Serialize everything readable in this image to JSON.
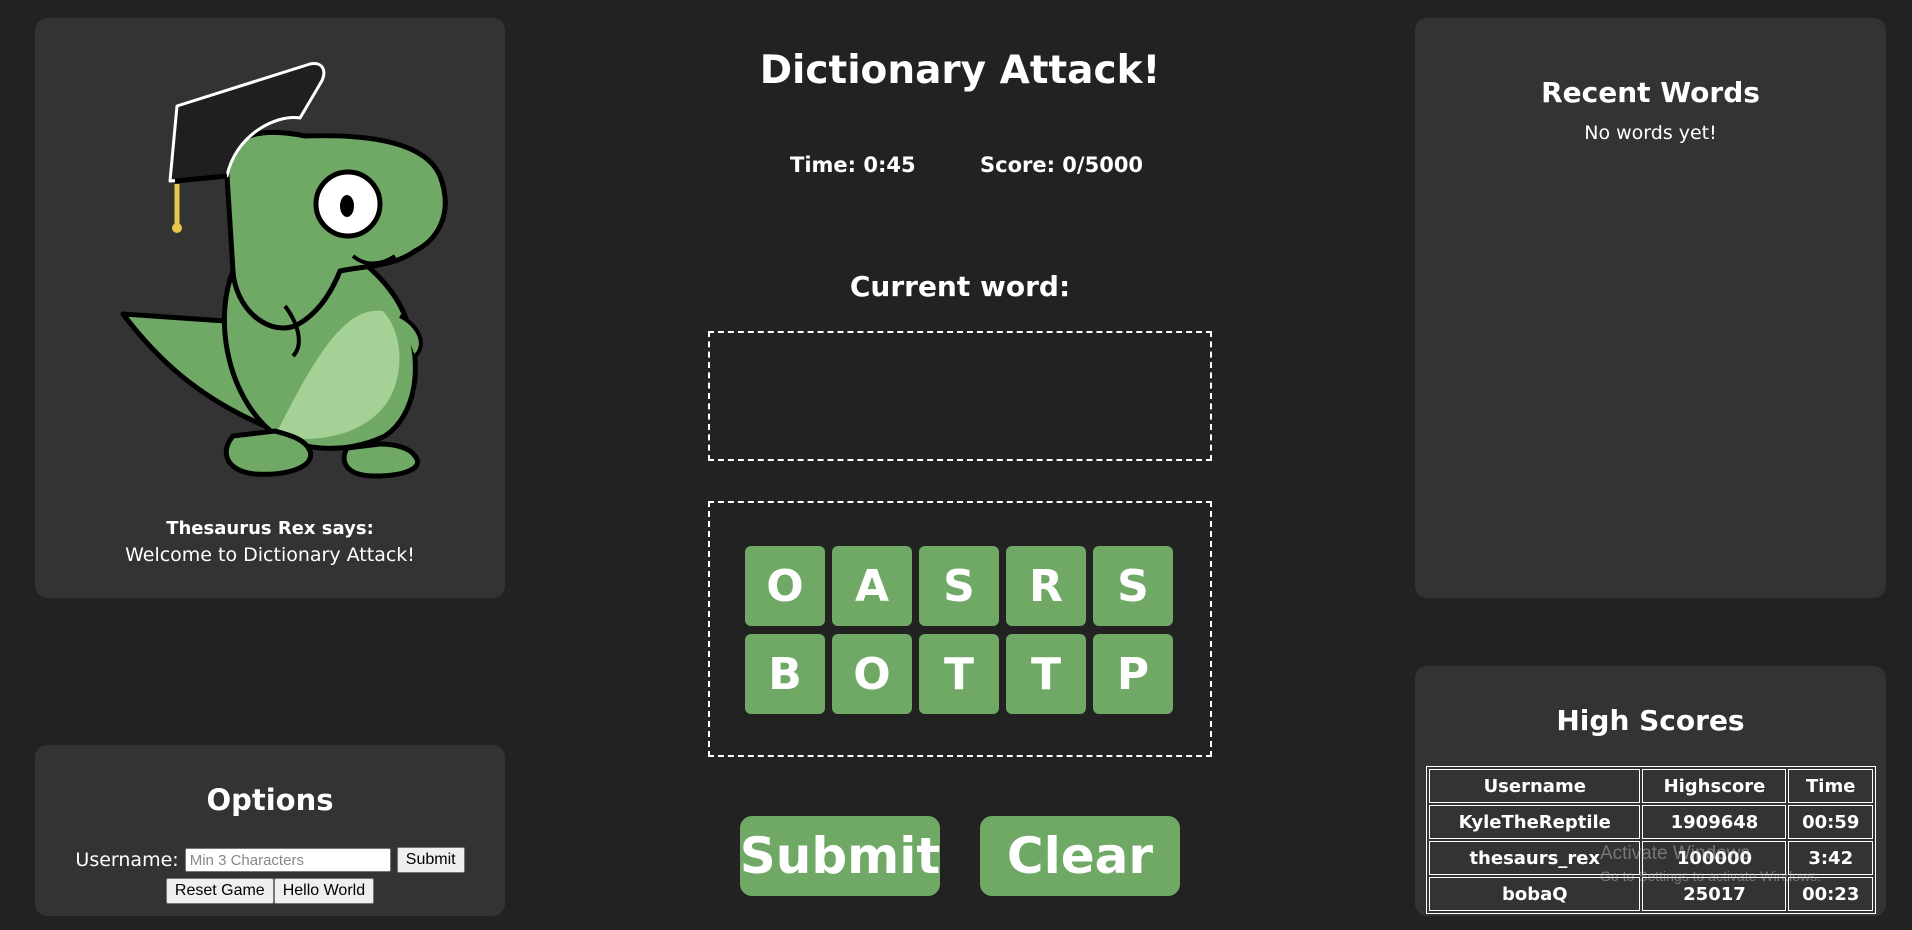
{
  "mascot": {
    "says_title": "Thesaurus Rex says:",
    "message": "Welcome to Dictionary Attack!"
  },
  "options": {
    "title": "Options",
    "username_label": "Username:",
    "username_placeholder": "Min 3 Characters",
    "username_value": "",
    "submit_label": "Submit",
    "reset_label": "Reset Game",
    "hello_label": "Hello World"
  },
  "game": {
    "title": "Dictionary Attack!",
    "time": "Time: 0:45",
    "score": "Score: 0/5000",
    "current_word_label": "Current word:",
    "current_word": "",
    "tiles": [
      "O",
      "A",
      "S",
      "R",
      "S",
      "B",
      "O",
      "T",
      "T",
      "P"
    ],
    "submit_label": "Submit",
    "clear_label": "Clear"
  },
  "recent": {
    "title": "Recent Words",
    "empty_text": "No words yet!"
  },
  "high_scores": {
    "title": "High Scores",
    "columns": [
      "Username",
      "Highscore",
      "Time"
    ],
    "rows": [
      [
        "KyleTheReptile",
        "1909648",
        "00:59"
      ],
      [
        "thesaurs_rex",
        "100000",
        "3:42"
      ],
      [
        "bobaQ",
        "25017",
        "00:23"
      ]
    ]
  },
  "watermark": {
    "line1": "Activate Windows",
    "line2": "Go to Settings to activate Windows."
  },
  "colors": {
    "background": "#222222",
    "panel": "#333333",
    "tile": "#6fa965",
    "dino_body": "#6fa965",
    "dino_belly": "#a5d197"
  }
}
